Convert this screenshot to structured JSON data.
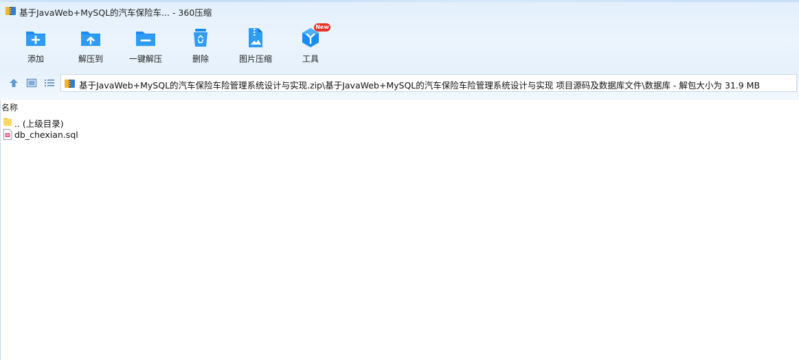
{
  "window": {
    "title": "基于JavaWeb+MySQL的汽车保险车... - 360压缩",
    "app_icon": "360zip-archive-icon"
  },
  "toolbar": {
    "buttons": [
      {
        "label": "添加",
        "icon": "add-folder-icon"
      },
      {
        "label": "解压到",
        "icon": "extract-to-folder-icon"
      },
      {
        "label": "一键解压",
        "icon": "one-click-extract-folder-icon"
      },
      {
        "label": "删除",
        "icon": "recycle-bin-icon"
      },
      {
        "label": "图片压缩",
        "icon": "image-compress-icon"
      },
      {
        "label": "工具",
        "icon": "tools-hexagon-icon"
      }
    ],
    "new_badge": "New"
  },
  "nav": {
    "icons": [
      "up-arrow-icon",
      "thumbnail-view-icon",
      "list-view-icon"
    ]
  },
  "address_bar": {
    "path": "基于JavaWeb+MySQL的汽车保险车险管理系统设计与实现.zip\\基于JavaWeb+MySQL的汽车保险车险管理系统设计与实现 项目源码及数据库文件\\数据库 - 解包大小为 31.9 MB"
  },
  "file_list": {
    "column_header": "名称",
    "items": [
      {
        "name": ".. (上级目录)",
        "icon": "folder-icon"
      },
      {
        "name": "db_chexian.sql",
        "icon": "sql-file-icon"
      }
    ]
  },
  "colors": {
    "accent_blue": "#1a8cf0",
    "badge_red": "#e8312b",
    "toolbar_bg": "#e6f1fc"
  }
}
